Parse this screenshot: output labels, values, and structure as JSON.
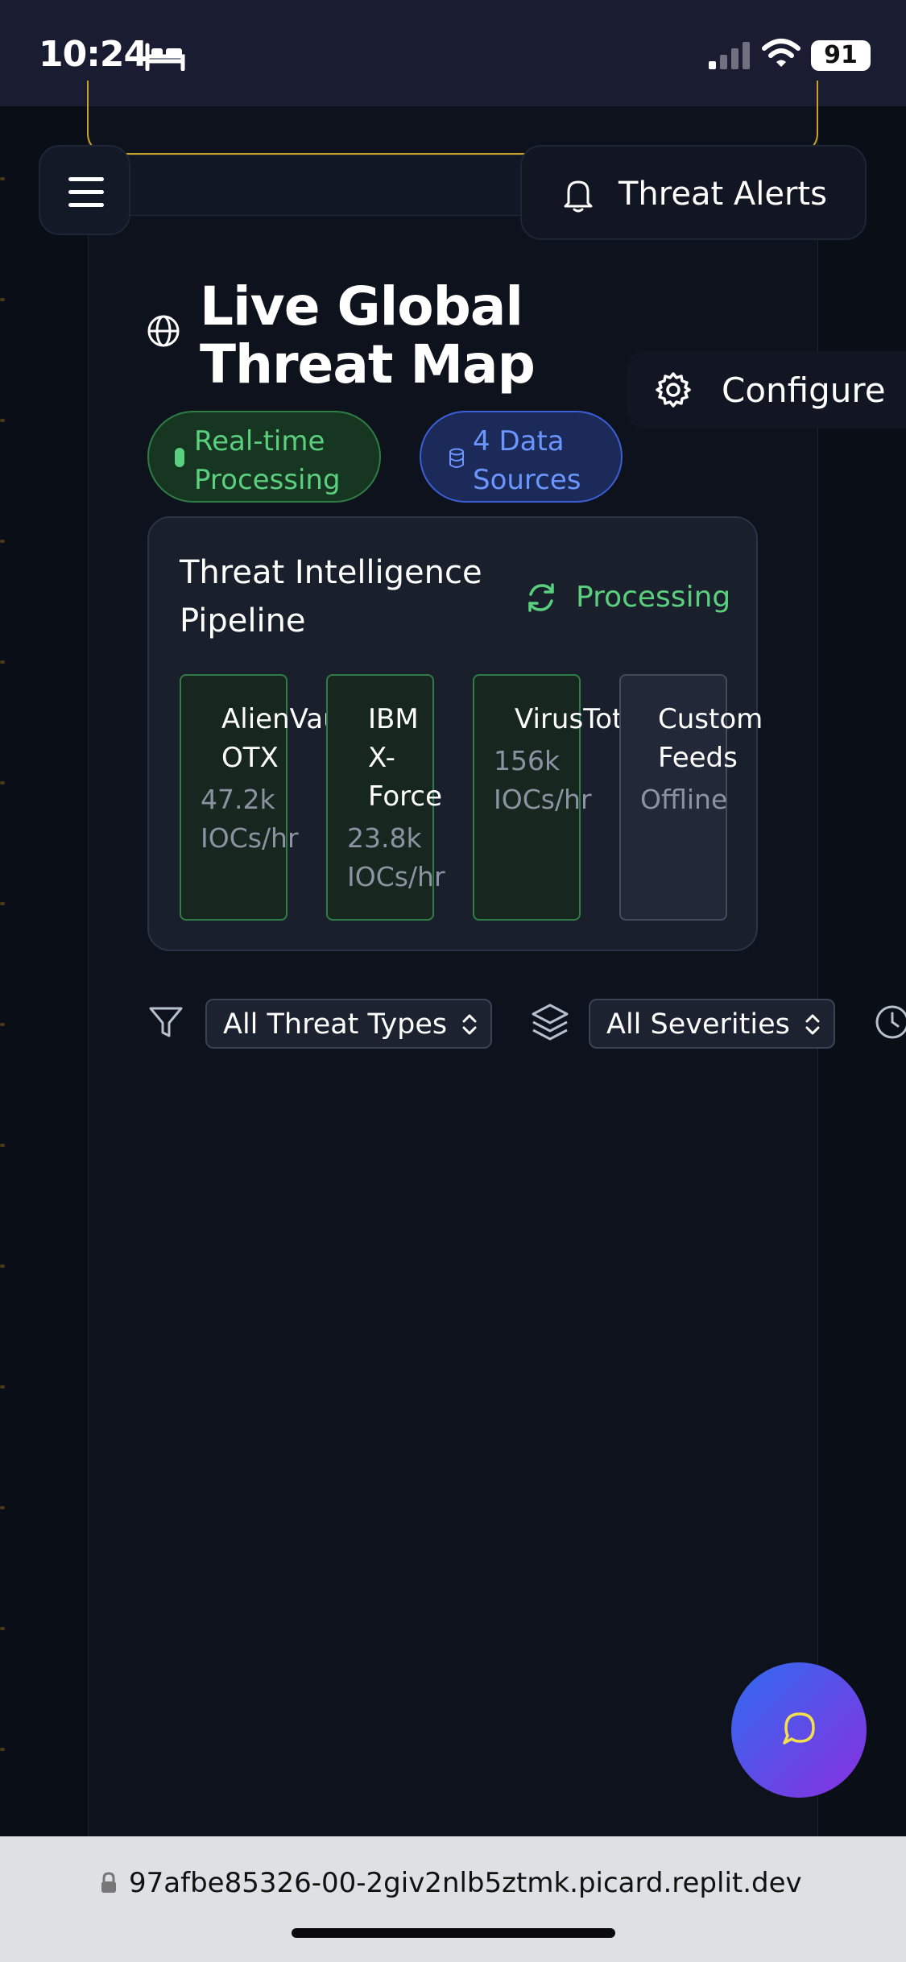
{
  "status_bar": {
    "time": "10:24",
    "battery": "91"
  },
  "header": {
    "alerts_label": "Threat Alerts"
  },
  "page": {
    "title": "Live Global Threat Map",
    "configure_label": "Configure"
  },
  "pills": {
    "realtime": "Real-time Processing",
    "sources": "4 Data Sources"
  },
  "pipeline": {
    "title": "Threat Intelligence Pipeline",
    "status": "Processing",
    "sources": [
      {
        "name": "AlienVault OTX",
        "rate": "47.2k IOCs/hr",
        "state": "online"
      },
      {
        "name": "IBM X-Force",
        "rate": "23.8k IOCs/hr",
        "state": "online"
      },
      {
        "name": "VirusTotal",
        "rate": "156k IOCs/hr",
        "state": "online"
      },
      {
        "name": "Custom Feeds",
        "rate": "Offline",
        "state": "offline"
      }
    ]
  },
  "filters": {
    "threat_type": "All Threat Types",
    "severity": "All Severities"
  },
  "browser": {
    "url": "97afbe85326-00-2giv2nlb5ztmk.picard.replit.dev"
  },
  "colors": {
    "accent_green": "#5ad07f",
    "accent_blue": "#6b96ff",
    "border_gold": "#c9a227"
  }
}
